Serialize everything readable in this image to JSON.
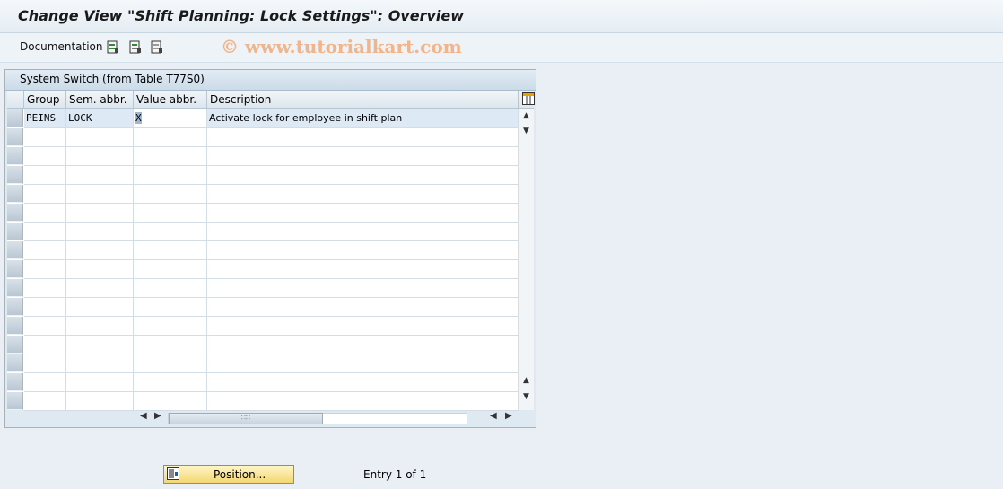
{
  "title": "Change View \"Shift Planning: Lock Settings\": Overview",
  "toolbar": {
    "documentation_label": "Documentation"
  },
  "watermark": "© www.tutorialkart.com",
  "panel": {
    "title": "System Switch (from Table T77S0)",
    "columns": [
      "Group",
      "Sem. abbr.",
      "Value abbr.",
      "Description"
    ],
    "rows": [
      {
        "group": "PEINS",
        "sem_abbr": "LOCK",
        "value_abbr": "X",
        "description": "Activate lock for employee in shift plan"
      }
    ]
  },
  "footer": {
    "position_label": "Position...",
    "entry_text": "Entry 1 of 1"
  }
}
